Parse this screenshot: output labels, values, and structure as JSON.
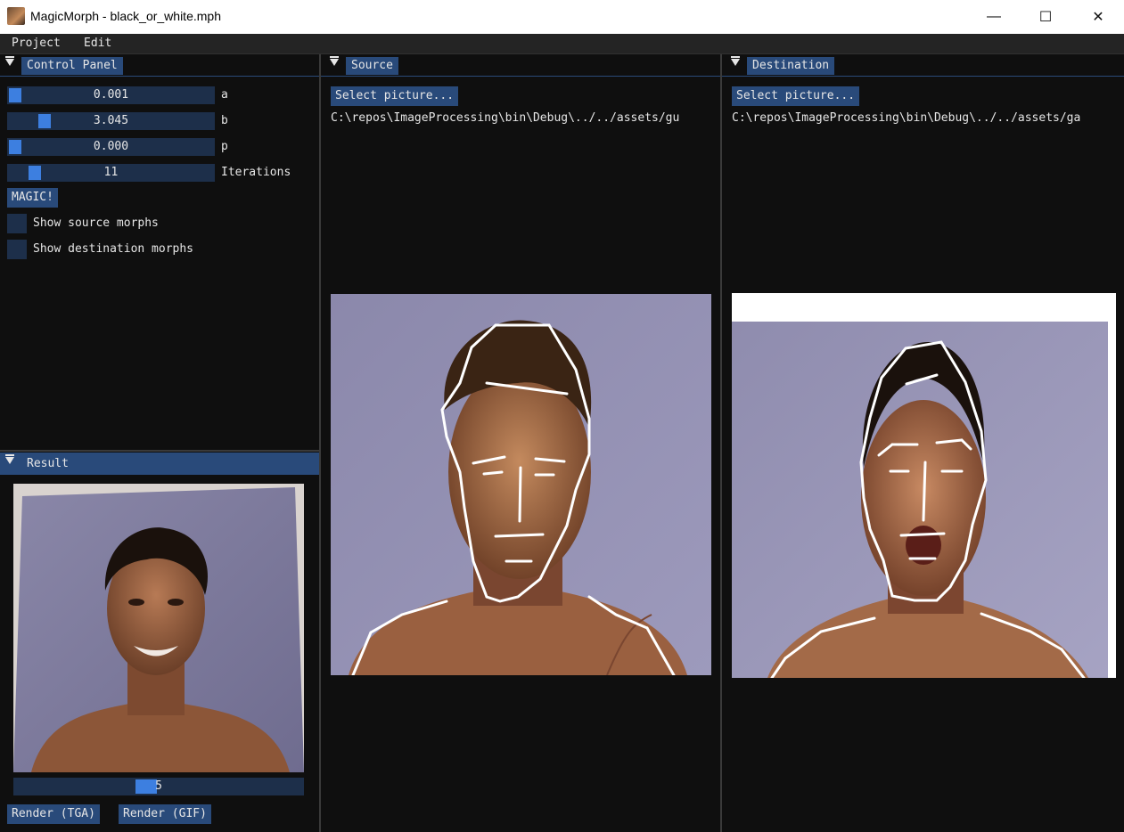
{
  "window": {
    "title": "MagicMorph - black_or_white.mph",
    "minimize_glyph": "—",
    "maximize_glyph": "☐",
    "close_glyph": "✕"
  },
  "menu": {
    "items": [
      "Project",
      "Edit"
    ]
  },
  "control_panel": {
    "title": "Control Panel",
    "sliders": [
      {
        "label": "a",
        "value": "0.001",
        "fraction": 0.0
      },
      {
        "label": "b",
        "value": "3.045",
        "fraction": 0.18
      },
      {
        "label": "p",
        "value": "0.000",
        "fraction": 0.0
      },
      {
        "label": "Iterations",
        "value": "11",
        "fraction": 0.12
      }
    ],
    "magic_button": "MAGIC!",
    "checkboxes": [
      {
        "label": "Show source morphs",
        "checked": false
      },
      {
        "label": "Show destination morphs",
        "checked": false
      }
    ]
  },
  "result": {
    "title": "Result",
    "frame_slider": {
      "value": "5",
      "fraction": 0.5
    },
    "render_tga": "Render (TGA)",
    "render_gif": "Render (GIF)"
  },
  "source": {
    "title": "Source",
    "select_button": "Select picture...",
    "path": "C:\\repos\\ImageProcessing\\bin\\Debug\\../../assets/gu"
  },
  "destination": {
    "title": "Destination",
    "select_button": "Select picture...",
    "path": "C:\\repos\\ImageProcessing\\bin\\Debug\\../../assets/ga"
  },
  "colors": {
    "accent": "#294a7a",
    "slider_grab": "#3d7fe0",
    "frame_bg": "#1d2f4a",
    "background": "#0f0f0f"
  }
}
